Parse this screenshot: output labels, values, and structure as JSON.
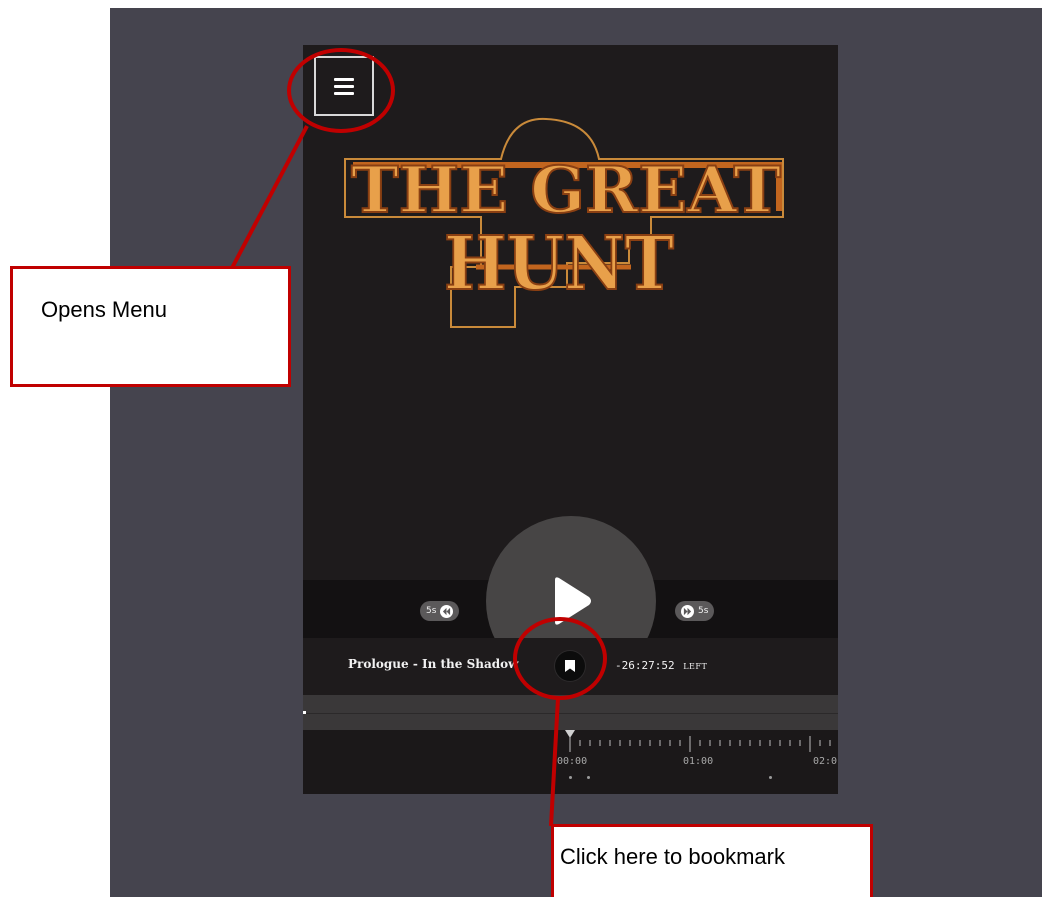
{
  "logo": {
    "line1": "THE GREAT",
    "line2": "HUNT"
  },
  "controls": {
    "skip_back_label": "5s",
    "skip_forward_label": "5s"
  },
  "info": {
    "chapter_title": "Prologue - In the Shadow",
    "time_remaining": "-26:27:52",
    "time_suffix": "LEFT"
  },
  "timeline": {
    "labels": [
      "00:00",
      "01:00",
      "02:0"
    ]
  },
  "annotations": {
    "menu_callout": "Opens Menu",
    "bookmark_callout": "Click here to bookmark"
  },
  "colors": {
    "backdrop": "#45444e",
    "player_bg": "#1e1b1c",
    "logo_fill": "#e8a04a",
    "logo_outline": "#c2651e",
    "callout_red": "#c00000"
  },
  "icons": {
    "menu": "hamburger-icon",
    "play": "play-icon",
    "rewind": "rewind-icon",
    "forward": "fast-forward-icon",
    "bookmark": "bookmark-icon"
  }
}
